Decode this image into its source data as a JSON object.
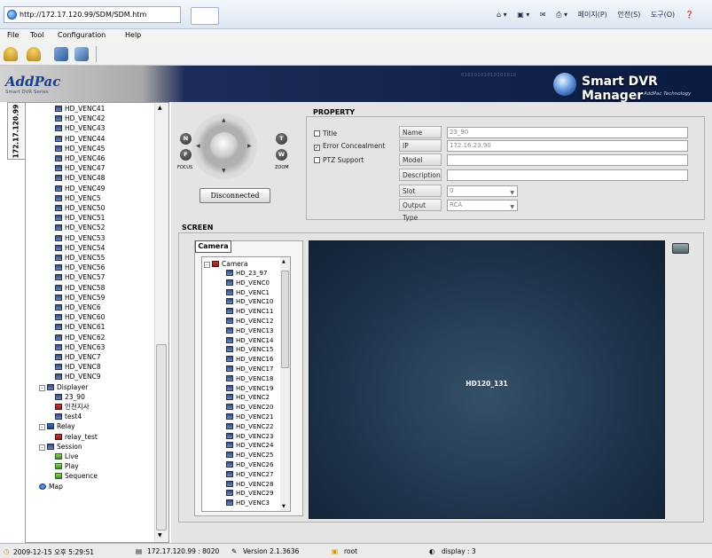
{
  "ie": {
    "url": "http://172.17.120.99/SDM/SDM.htm",
    "commands": [
      "페이지(P)",
      "안전(S)",
      "도구(O)"
    ]
  },
  "menu": {
    "items": [
      "File",
      "Tool",
      "Configuration",
      "Help"
    ]
  },
  "banner": {
    "logo": "AddPac",
    "logo_sub": "Smart DVR Series",
    "binary": "01010101010101010",
    "title": "Smart DVR Manager",
    "sub": "AddPac Technology"
  },
  "sidebar": {
    "tab_label": "172.17.120.99",
    "venc_items": [
      "HD_VENC41",
      "HD_VENC42",
      "HD_VENC43",
      "HD_VENC44",
      "HD_VENC45",
      "HD_VENC46",
      "HD_VENC47",
      "HD_VENC48",
      "HD_VENC49",
      "HD_VENC5",
      "HD_VENC50",
      "HD_VENC51",
      "HD_VENC52",
      "HD_VENC53",
      "HD_VENC54",
      "HD_VENC55",
      "HD_VENC56",
      "HD_VENC57",
      "HD_VENC58",
      "HD_VENC59",
      "HD_VENC6",
      "HD_VENC60",
      "HD_VENC61",
      "HD_VENC62",
      "HD_VENC63",
      "HD_VENC7",
      "HD_VENC8",
      "HD_VENC9"
    ],
    "displayer": {
      "label": "Displayer",
      "children": [
        "23_90",
        "인천지사",
        "test4"
      ]
    },
    "relay": {
      "label": "Relay",
      "children": [
        "relay_test"
      ]
    },
    "session": {
      "label": "Session",
      "children": [
        "Live",
        "Play",
        "Sequence"
      ]
    },
    "map": "Map"
  },
  "ptz": {
    "n": "N",
    "f": "F",
    "t": "T",
    "w": "W",
    "focus": "FOCUS",
    "zoom": "ZOOM",
    "disconnected": "Disconnected"
  },
  "property": {
    "legend": "PROPERTY",
    "checks": [
      {
        "label": "Title",
        "checked": false
      },
      {
        "label": "Error Concealment",
        "checked": true
      },
      {
        "label": "PTZ Support",
        "checked": false
      }
    ],
    "fields": {
      "name": {
        "label": "Name",
        "value": "23_90"
      },
      "ip": {
        "label": "IP",
        "value": "172.16.23.90"
      },
      "model": {
        "label": "Model",
        "value": ""
      },
      "description": {
        "label": "Description",
        "value": ""
      },
      "slot": {
        "label": "Slot",
        "value": "0"
      },
      "output": {
        "label": "Output Type",
        "value": "RCA"
      }
    }
  },
  "screen": {
    "legend": "SCREEN",
    "camera_tab": "Camera",
    "camera_root": "Camera",
    "cameras": [
      "HD_23_97",
      "HD_VENC0",
      "HD_VENC1",
      "HD_VENC10",
      "HD_VENC11",
      "HD_VENC12",
      "HD_VENC13",
      "HD_VENC14",
      "HD_VENC15",
      "HD_VENC16",
      "HD_VENC17",
      "HD_VENC18",
      "HD_VENC19",
      "HD_VENC2",
      "HD_VENC20",
      "HD_VENC21",
      "HD_VENC22",
      "HD_VENC23",
      "HD_VENC24",
      "HD_VENC25",
      "HD_VENC26",
      "HD_VENC27",
      "HD_VENC28",
      "HD_VENC29",
      "HD_VENC3"
    ],
    "video_label": "HD120_131"
  },
  "status": {
    "time": "2009-12-15 오후 5:29:51",
    "host": "172.17.120.99 : 8020",
    "version": "Version 2.1.3636",
    "user": "root",
    "display": "display : 3"
  }
}
